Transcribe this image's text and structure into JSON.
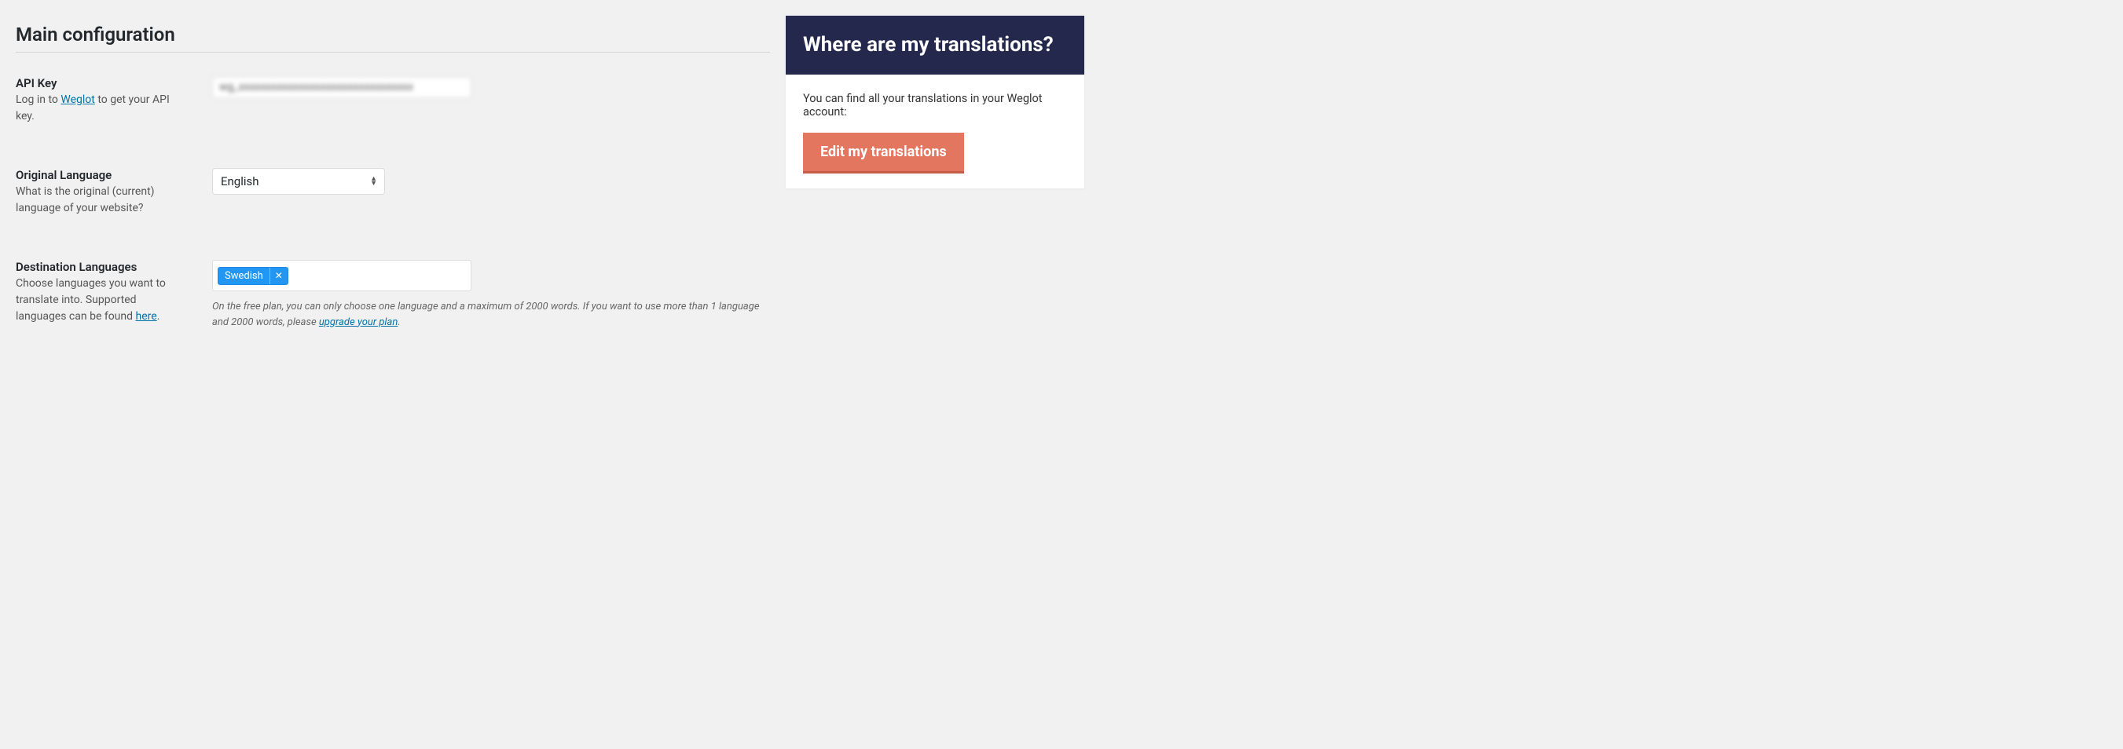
{
  "main": {
    "title": "Main configuration",
    "fields": {
      "api_key": {
        "label": "API Key",
        "desc_pre": "Log in to ",
        "desc_link": "Weglot",
        "desc_post": " to get your API key.",
        "value": "wg_xxxxxxxxxxxxxxxxxxxxxxxxxxxxxxxx"
      },
      "original_language": {
        "label": "Original Language",
        "desc": "What is the original (current) language of your website?",
        "value": "English"
      },
      "destination_languages": {
        "label": "Destination Languages",
        "desc_pre": "Choose languages you want to translate into. Supported languages can be found ",
        "desc_link": "here",
        "desc_post": ".",
        "tags": [
          {
            "label": "Swedish"
          }
        ],
        "hint_pre": "On the free plan, you can only choose one language and a maximum of 2000 words. If you want to use more than 1 language and 2000 words, please ",
        "hint_link": "upgrade your plan",
        "hint_post": "."
      }
    }
  },
  "sidebar": {
    "header": "Where are my translations?",
    "body": "You can find all your translations in your Weglot account:",
    "button": "Edit my translations"
  }
}
